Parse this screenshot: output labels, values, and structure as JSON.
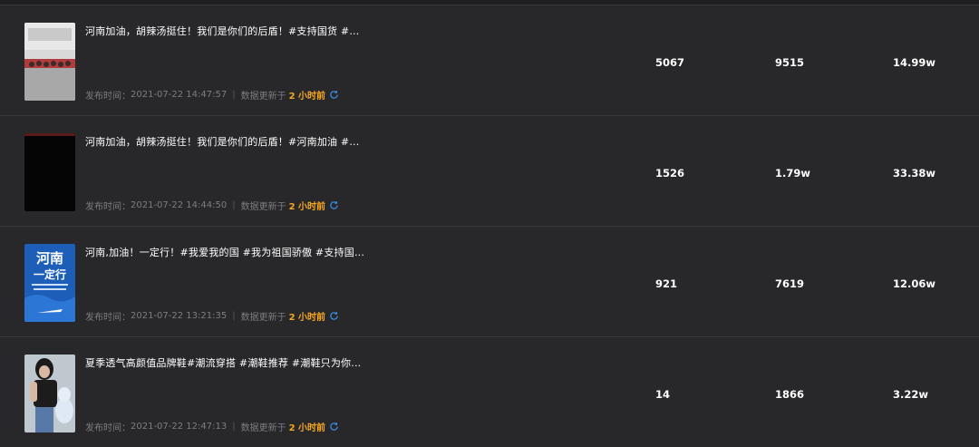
{
  "rows": [
    {
      "title": "河南加油，胡辣汤挺住！我们是你们的后盾！#支持国货 #...",
      "time_label": "发布时间：",
      "time": "2021-07-22 14:47:57",
      "update_label": "数据更新于",
      "update_ago": "2 小时前",
      "col1": "5067",
      "col2": "9515",
      "col3": "14.99w",
      "thumb": "crowd-photo"
    },
    {
      "title": "河南加油，胡辣汤挺住！我们是你们的后盾！#河南加油 #...",
      "time_label": "发布时间：",
      "time": "2021-07-22 14:44:50",
      "update_label": "数据更新于",
      "update_ago": "2 小时前",
      "col1": "1526",
      "col2": "1.79w",
      "col3": "33.38w",
      "thumb": "dark-video"
    },
    {
      "title": "河南,加油！一定行！#我爱我的国 #我为祖国骄傲 #支持国...",
      "time_label": "发布时间：",
      "time": "2021-07-22 13:21:35",
      "update_label": "数据更新于",
      "update_ago": "2 小时前",
      "col1": "921",
      "col2": "7619",
      "col3": "12.06w",
      "thumb": "henan-poster",
      "thumb_text": [
        "河南",
        "一定行"
      ]
    },
    {
      "title": "夏季透气高颜值品牌鞋#潮流穿搭 #潮鞋推荐 #潮鞋只为你...",
      "time_label": "发布时间：",
      "time": "2021-07-22 12:47:13",
      "update_label": "数据更新于",
      "update_ago": "2 小时前",
      "col1": "14",
      "col2": "1866",
      "col3": "3.22w",
      "thumb": "person-photo"
    }
  ],
  "colors": {
    "background": "#28282b",
    "divider": "#38383c",
    "accent": "#f5a623",
    "refresh": "#3a8ee6"
  }
}
